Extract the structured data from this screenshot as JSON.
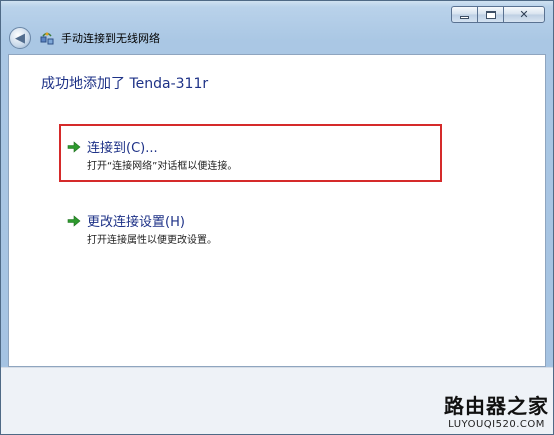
{
  "window": {
    "title": "手动连接到无线网络",
    "controls": {
      "minimize": "minimize",
      "maximize": "maximize",
      "close": "✕"
    }
  },
  "content": {
    "success_title": "成功地添加了 Tenda-311r",
    "options": [
      {
        "title": "连接到(C)...",
        "description": "打开“连接网络”对话框以便连接。"
      },
      {
        "title": "更改连接设置(H)",
        "description": "打开连接属性以便更改设置。"
      }
    ]
  },
  "watermark": {
    "brand": "路由器之家",
    "site": "LUYOUQI520.COM"
  },
  "colors": {
    "link": "#1e3287",
    "highlight": "#d52a2a",
    "arrow": "#2e9a2e"
  },
  "icons": [
    "back-arrow-icon",
    "network-icon",
    "green-arrow-icon"
  ]
}
